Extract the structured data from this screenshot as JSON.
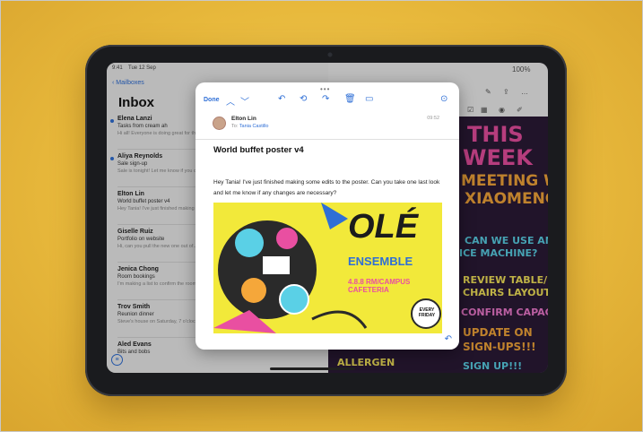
{
  "status_bar": {
    "time": "9:41",
    "date": "Tue 12 Sep",
    "battery": "100%"
  },
  "mail": {
    "back_label": "Mailboxes",
    "title": "Inbox",
    "items": [
      {
        "sender": "Elena Lanzi",
        "subject": "Tasks from cream ah",
        "preview": "Hi all! Everyone is doing great for the...",
        "unread": true
      },
      {
        "sender": "Aliya Reynolds",
        "subject": "Sale sign-up",
        "preview": "Sale is tonight! Let me know if you can...",
        "unread": true
      },
      {
        "sender": "Elton Lin",
        "subject": "World buffet poster v4",
        "preview": "Hey Tania! I've just finished making some...",
        "unread": false
      },
      {
        "sender": "Giselle Ruiz",
        "subject": "Portfolio on website",
        "preview": "Hi, can you pull the new one out of...",
        "unread": false
      },
      {
        "sender": "Jenica Chong",
        "subject": "Room bookings",
        "preview": "I'm making a list to confirm the rooms...",
        "unread": false
      },
      {
        "sender": "Trov Smith",
        "subject": "Reunion dinner",
        "preview": "Steve's house on Saturday, 7 o'clock...",
        "unread": false
      },
      {
        "sender": "Aled Evans",
        "subject": "Bits and bobs",
        "preview": "",
        "unread": false
      }
    ]
  },
  "email": {
    "toolbar": {
      "done": "Done"
    },
    "from": "Elton Lin",
    "to_label": "To:",
    "to": "Tania Castillo",
    "time": "09:52",
    "subject": "World buffet poster v4",
    "body": "Hey Tania! I've just finished making some edits to the poster. Can you take one last look and let me know if any changes are necessary?",
    "poster": {
      "headline": "OLÉ",
      "subhead": "ENSEMBLE",
      "date_line": "4.8.8 RM/CAMPUS CAFETERIA",
      "badge": "EVERY FRIDAY"
    }
  },
  "notes": {
    "lines": [
      "THIS",
      "WEEK",
      "MEETING WITH",
      "XIAOMENG",
      "CAN WE USE AN",
      "ICE MACHINE?",
      "REVIEW TABLE/",
      "CHAIRS LAYOUT",
      "CONFIRM CAPACITY",
      "UPDATE ON",
      "SIGN-UPS!!!",
      "ALLERGEN",
      "SIGN UP!!!"
    ]
  },
  "colors": {
    "accent": "#2f6fd6",
    "background": "#e8b93c",
    "poster_yellow": "#f2e93a",
    "notes_board": "#2b1a36"
  }
}
